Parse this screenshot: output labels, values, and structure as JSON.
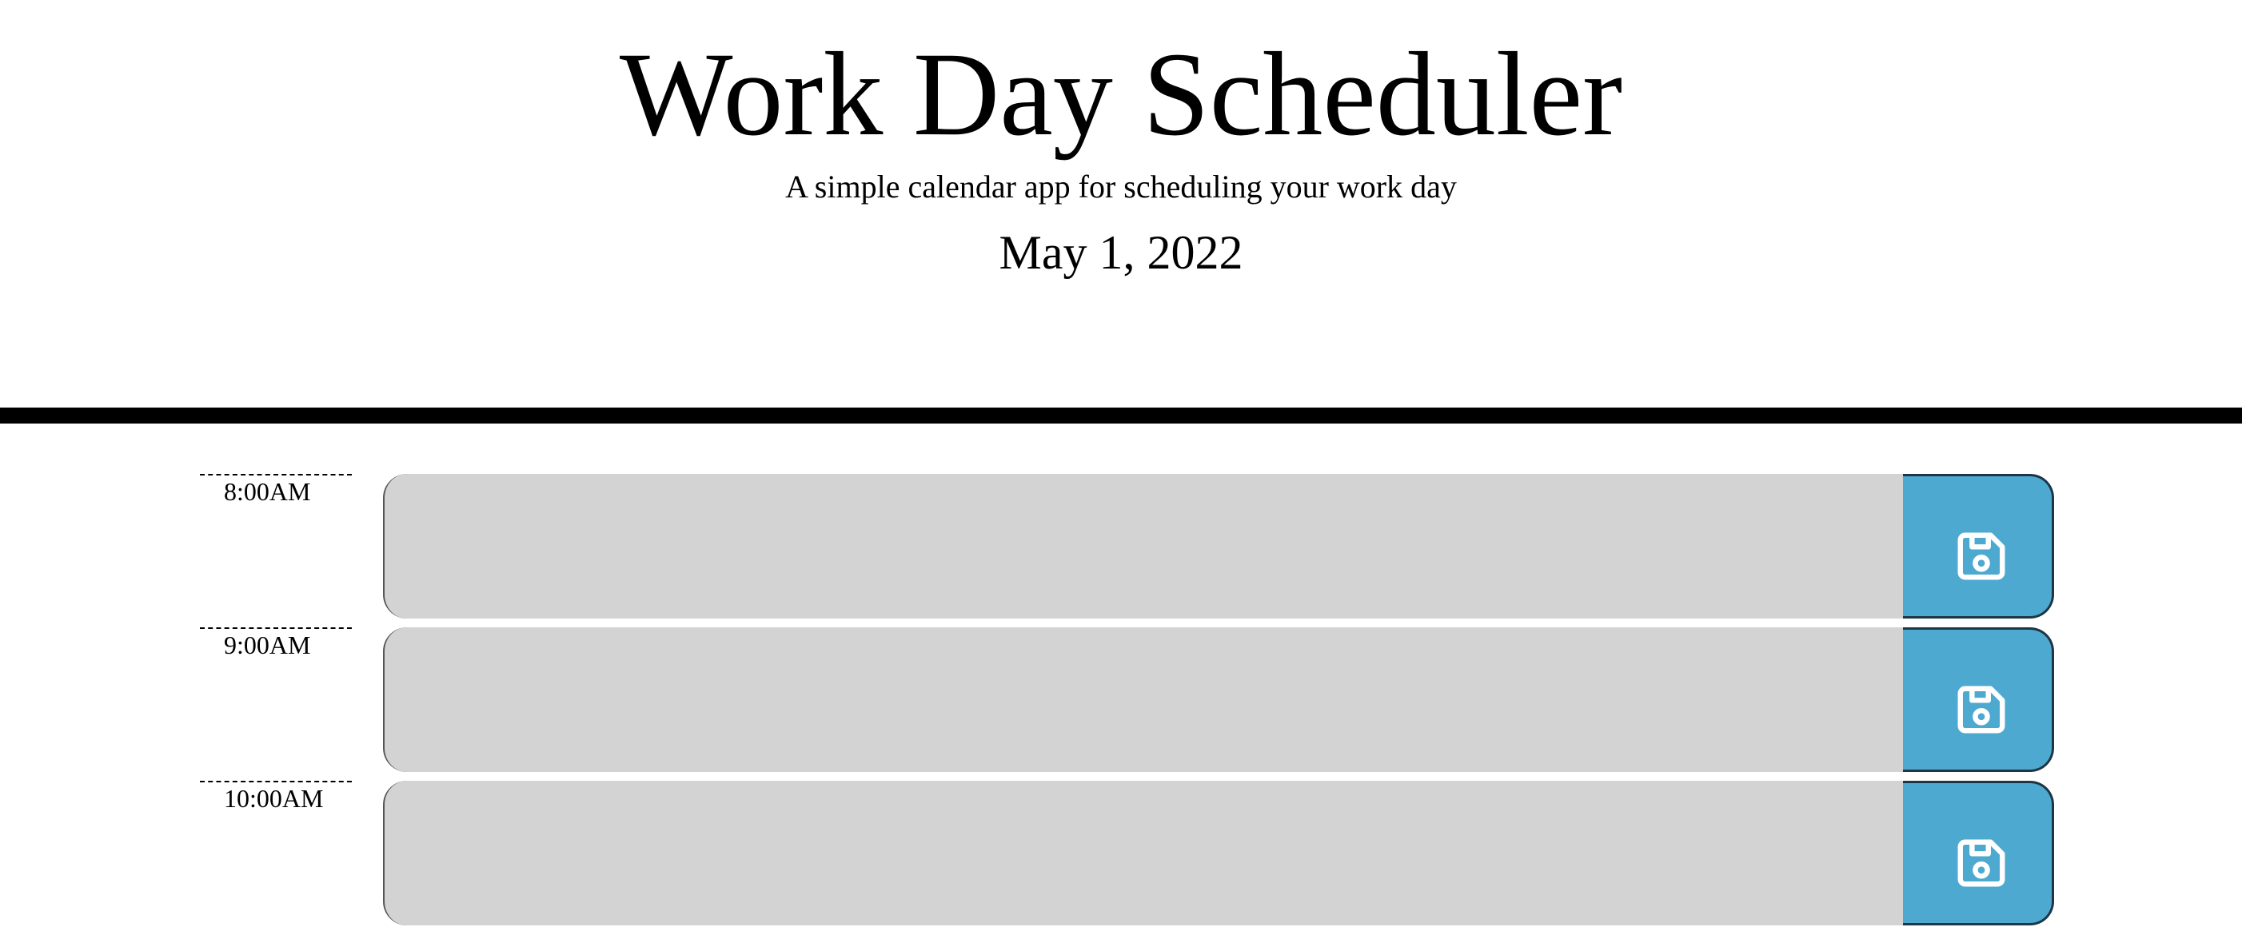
{
  "header": {
    "title": "Work Day Scheduler",
    "subtitle": "A simple calendar app for scheduling your work day",
    "current_date": "May 1, 2022"
  },
  "colors": {
    "past_block": "#d3d3d3",
    "save_button": "#4ea9d1",
    "divider": "#000000"
  },
  "time_blocks": [
    {
      "hour": "8:00AM",
      "text": "",
      "save_icon": "floppy-disk-icon"
    },
    {
      "hour": "9:00AM",
      "text": "",
      "save_icon": "floppy-disk-icon"
    },
    {
      "hour": "10:00AM",
      "text": "",
      "save_icon": "floppy-disk-icon"
    }
  ]
}
